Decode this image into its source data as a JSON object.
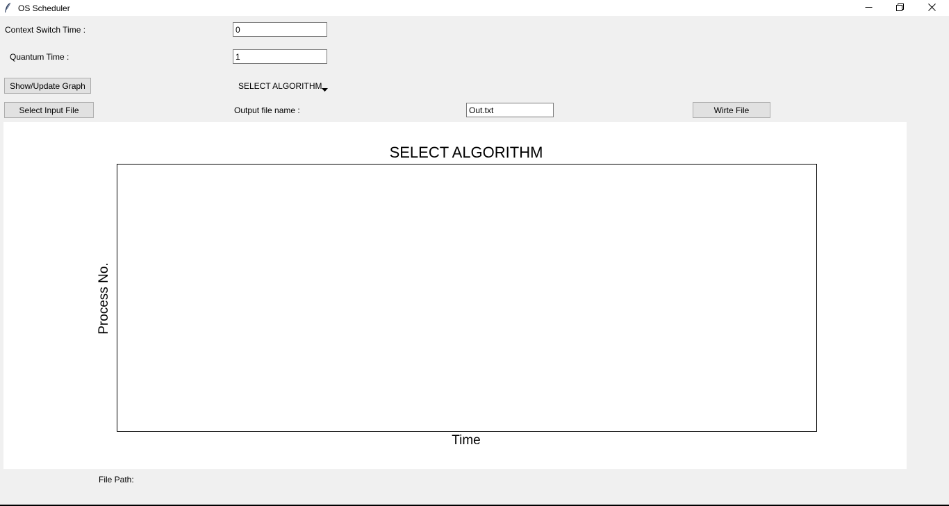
{
  "window": {
    "title": "OS Scheduler",
    "icons": {
      "app": "feather-icon",
      "minimize": "minimize-icon",
      "maximize": "restore-icon",
      "close": "close-icon"
    }
  },
  "form": {
    "context_switch_label": "Context Switch Time :",
    "context_switch_value": "0",
    "quantum_label": "Quantum Time :",
    "quantum_value": "1",
    "show_graph_button": "Show/Update Graph",
    "algorithm_selected": "SELECT ALGORITHM",
    "select_input_button": "Select Input File",
    "output_file_label": "Output file name :",
    "output_file_value": "Out.txt",
    "write_file_button": "Wirte File"
  },
  "chart_data": {
    "type": "bar",
    "title": "SELECT ALGORITHM",
    "xlabel": "Time",
    "ylabel": "Process No.",
    "series": [],
    "grid": false
  },
  "footer": {
    "file_path_label": "File Path:"
  }
}
